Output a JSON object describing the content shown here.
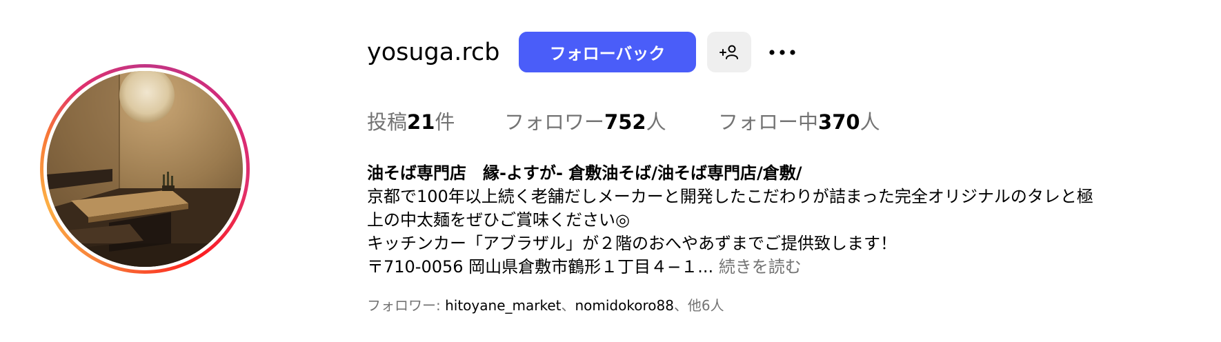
{
  "profile": {
    "username": "yosuga.rcb",
    "follow_back_label": "フォローバック",
    "suggest_icon": "person-add-icon",
    "more_icon": "more-options-icon",
    "avatar_icon": "profile-photo",
    "accent_color": "#4a5df9"
  },
  "stats": {
    "posts_label": "投稿",
    "posts_count": "21",
    "posts_unit": "件",
    "followers_label": "フォロワー",
    "followers_count": "752",
    "followers_unit": "人",
    "following_label": "フォロー中",
    "following_count": "370",
    "following_unit": "人"
  },
  "bio": {
    "name": "油そば専門店　縁-よすが- 倉敷油そば/油そば専門店/倉敷/",
    "line1": "京都で100年以上続く老舗だしメーカーと開発したこだわりが詰まった完全オリジナルのタレと極",
    "line2": "上の中太麺をぜひご賞味ください◎",
    "line3": "キッチンカー「アブラザル」が２階のおへやあずまでご提供致します！",
    "line4": "〒710-0056 岡山県倉敷市鶴形１丁目４−１...",
    "more_label": "続きを読む"
  },
  "followed_by": {
    "prefix": "フォロワー: ",
    "account1": "hitoyane_market",
    "separator": "、",
    "account2": "nomidokoro88",
    "suffix": "、他6人"
  }
}
